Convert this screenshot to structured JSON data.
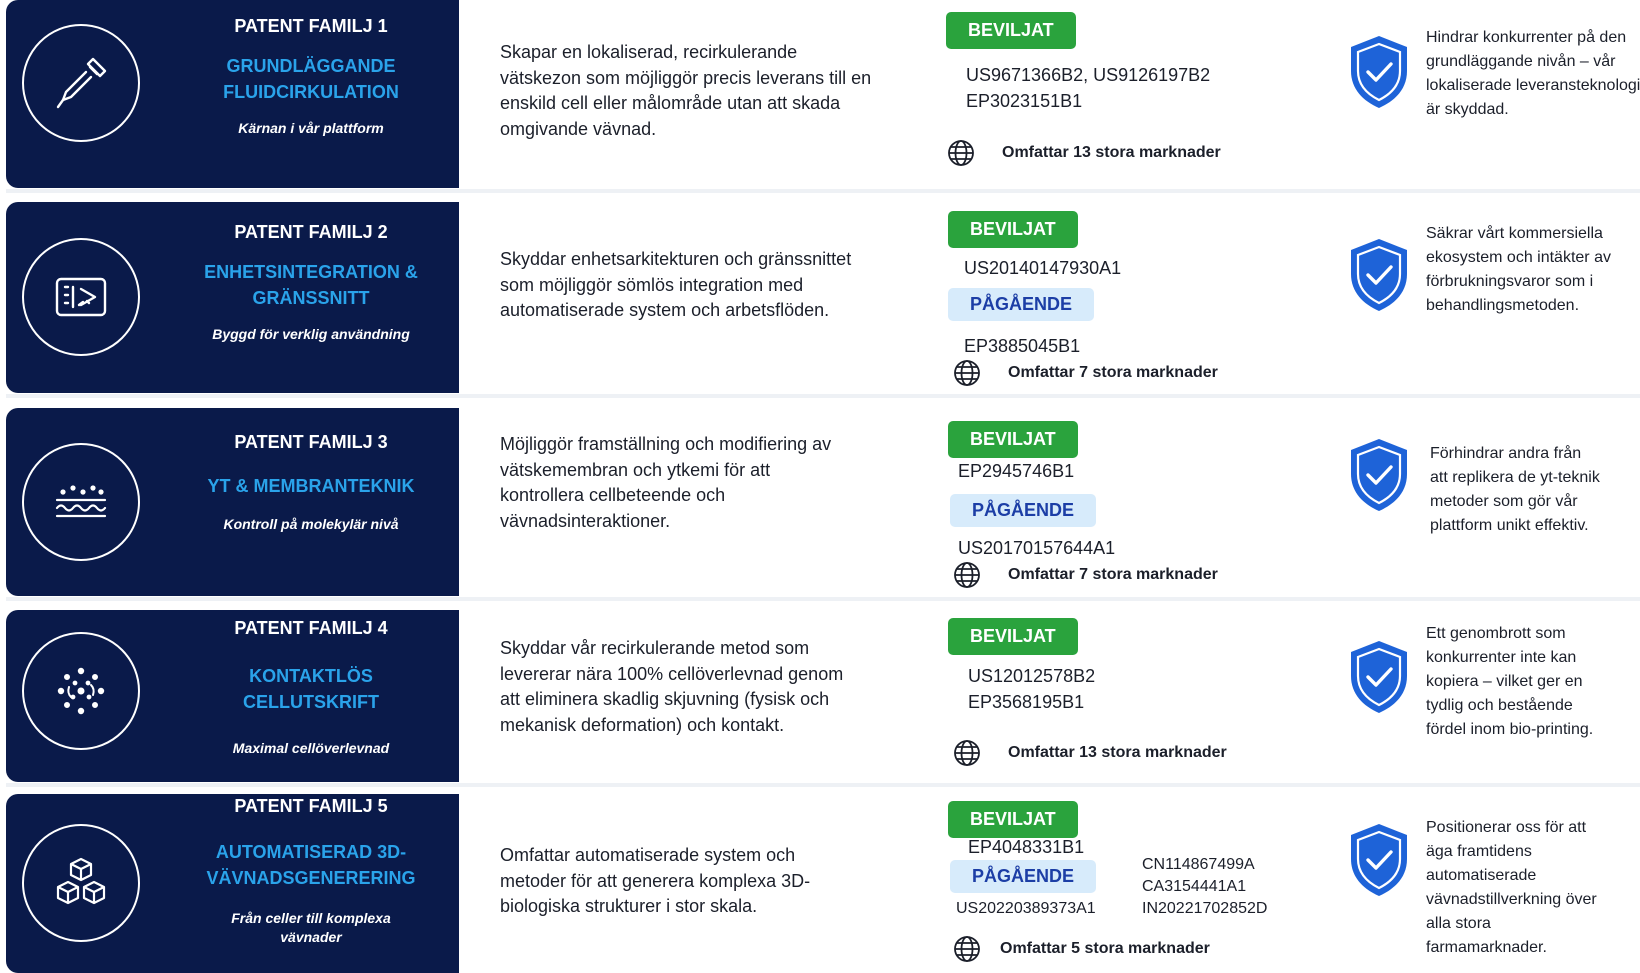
{
  "rows": [
    {
      "family": "PATENT FAMILJ 1",
      "title_lines": [
        "GRUNDLÄGGANDE",
        "FLUIDCIRKULATION"
      ],
      "tagline_lines": [
        "Kärnan i vår plattform"
      ],
      "icon": "dropper-icon",
      "description": "Skapar en lokaliserad, recirkulerande vätskezon som möjliggör precis leverans till en enskild cell eller målområde utan att skada omgivande vävnad.",
      "status_granted": "BEVILJAT",
      "granted_numbers": [
        "US9671366B2, US9126197B2",
        "EP3023151B1"
      ],
      "status_pending": "",
      "pending_numbers": [],
      "extra_numbers": [],
      "markets": "Omfattar 13 stora marknader",
      "benefit": "Hindrar konkurrenter på den grundläggande nivån – vår lokaliserade leveransteknologi är skyddad."
    },
    {
      "family": "PATENT FAMILJ 2",
      "title_lines": [
        "ENHETSINTEGRATION &",
        "GRÄNSSNITT"
      ],
      "tagline_lines": [
        "Byggd för verklig användning"
      ],
      "icon": "device-interface-icon",
      "description": "Skyddar enhetsarkitekturen och gränssnittet som möjliggör sömlös integration med automatiserade system och arbetsflöden.",
      "status_granted": "BEVILJAT",
      "granted_numbers": [
        "US20140147930A1"
      ],
      "status_pending": "PÅGÅENDE",
      "pending_numbers": [
        "EP3885045B1"
      ],
      "extra_numbers": [],
      "markets": "Omfattar 7 stora marknader",
      "benefit": "Säkrar vårt kommersiella ekosystem och intäkter av förbrukningsvaror som i behandlingsmetoden."
    },
    {
      "family": "PATENT FAMILJ 3",
      "title_lines": [
        "YT & MEMBRANTEKNIK"
      ],
      "tagline_lines": [
        "Kontroll på molekylär nivå"
      ],
      "icon": "membrane-icon",
      "description": "Möjliggör framställning och modifiering av vätskemembran och ytkemi för att kontrollera cellbeteende och vävnadsinteraktioner.",
      "status_granted": "BEVILJAT",
      "granted_numbers": [
        "EP2945746B1"
      ],
      "status_pending": "PÅGÅENDE",
      "pending_numbers": [
        "US20170157644A1"
      ],
      "extra_numbers": [],
      "markets": "Omfattar 7 stora marknader",
      "benefit": "Förhindrar andra från att replikera de yt-teknik metoder som gör vår plattform unikt effektiv."
    },
    {
      "family": "PATENT FAMILJ 4",
      "title_lines": [
        "KONTAKTLÖS",
        "CELLUTSKRIFT"
      ],
      "tagline_lines": [
        "Maximal cellöverlevnad"
      ],
      "icon": "cell-scatter-icon",
      "description": "Skyddar vår recirkulerande metod som levererar nära 100% cellöverlevnad genom att eliminera skadlig skjuvning (fysisk och mekanisk deformation) och kontakt.",
      "status_granted": "BEVILJAT",
      "granted_numbers": [
        "US12012578B2",
        "EP3568195B1"
      ],
      "status_pending": "",
      "pending_numbers": [],
      "extra_numbers": [],
      "markets": "Omfattar 13 stora marknader",
      "benefit": "Ett genombrott som konkurrenter inte kan kopiera – vilket ger en tydlig och bestående fördel inom bio-printing."
    },
    {
      "family": "PATENT FAMILJ 5",
      "title_lines": [
        "AUTOMATISERAD 3D-",
        "VÄVNADSGENERERING"
      ],
      "tagline_lines": [
        "Från celler till komplexa",
        "vävnader"
      ],
      "icon": "cubes-icon",
      "description": "Omfattar automatiserade system och metoder för att generera komplexa 3D-biologiska strukturer i stor skala.",
      "status_granted": "BEVILJAT",
      "granted_numbers": [
        "EP4048331B1"
      ],
      "status_pending": "PÅGÅENDE",
      "pending_numbers": [
        "US20220389373A1"
      ],
      "extra_numbers": [
        "CN114867499A",
        "CA3154441A1",
        "IN20221702852D"
      ],
      "markets": "Omfattar 5 stora marknader",
      "benefit": "Positionerar oss för att äga framtidens automatiserade vävnadstillverkning över alla stora farmamarknader."
    }
  ],
  "colors": {
    "navy": "#0a1a4a",
    "accent_blue": "#2aa3ea",
    "granted_green": "#2aa33d",
    "pending_bg": "#d7ebfb",
    "pending_text": "#1c3ea6",
    "shield_blue": "#1e63d8"
  }
}
